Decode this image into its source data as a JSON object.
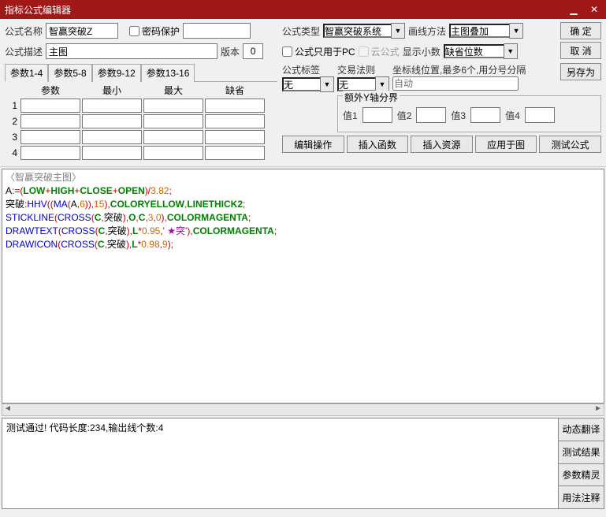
{
  "window": {
    "title": "指标公式编辑器"
  },
  "labels": {
    "formula_name": "公式名称",
    "password_protect": "密码保护",
    "formula_desc": "公式描述",
    "version": "版本",
    "formula_type": "公式类型",
    "draw_method": "画线方法",
    "pc_only": "公式只用于PC",
    "cloud_formula": "云公式",
    "show_decimal": "显示小数",
    "default_digits": "缺省位数",
    "formula_tag": "公式标签",
    "trade_rule": "交易法则",
    "coord_hint": "坐标线位置,最多6个,用分号分隔",
    "auto": "自动",
    "extra_y": "额外Y轴分界",
    "val1": "值1",
    "val2": "值2",
    "val3": "值3",
    "val4": "值4"
  },
  "values": {
    "formula_name": "智赢突破Z",
    "formula_desc": "主图",
    "version": "0",
    "formula_type": "智赢突破系统",
    "draw_method": "主图叠加",
    "default_digits": "缺省位数",
    "tag_value": "无",
    "rule_value": "无"
  },
  "buttons": {
    "ok": "确 定",
    "cancel": "取 消",
    "saveas": "另存为",
    "edit_op": "编辑操作",
    "insert_func": "插入函数",
    "insert_res": "插入资源",
    "apply_graph": "应用于图",
    "test_formula": "测试公式",
    "dyn_translate": "动态翻译",
    "test_result": "测试结果",
    "param_wizard": "参数精灵",
    "usage_note": "用法注释"
  },
  "param_tabs": [
    "参数1-4",
    "参数5-8",
    "参数9-12",
    "参数13-16"
  ],
  "param_headers": [
    "参数",
    "最小",
    "最大",
    "缺省"
  ],
  "param_rows": [
    "1",
    "2",
    "3",
    "4"
  ],
  "code_title": "〈智赢突破主图〉",
  "output_text": "测试通过! 代码长度:234,输出线个数:4"
}
